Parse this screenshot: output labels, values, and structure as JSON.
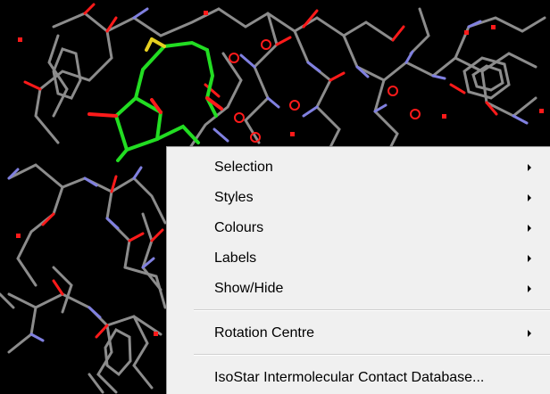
{
  "context_menu": {
    "items": [
      {
        "label": "Selection",
        "submenu": true
      },
      {
        "label": "Styles",
        "submenu": true
      },
      {
        "label": "Colours",
        "submenu": true
      },
      {
        "label": "Labels",
        "submenu": true
      },
      {
        "label": "Show/Hide",
        "submenu": true
      },
      {
        "label": "Rotation Centre",
        "submenu": true
      },
      {
        "label": "IsoStar Intermolecular Contact Database...",
        "submenu": false
      }
    ]
  },
  "colors": {
    "background": "#000000",
    "carbon": "#8c8c8c",
    "oxygen": "#ff1a1a",
    "nitrogen": "#8080e0",
    "highlight": "#22dd22",
    "sulfur": "#e6d020",
    "menu_bg": "#f0f0f0"
  }
}
